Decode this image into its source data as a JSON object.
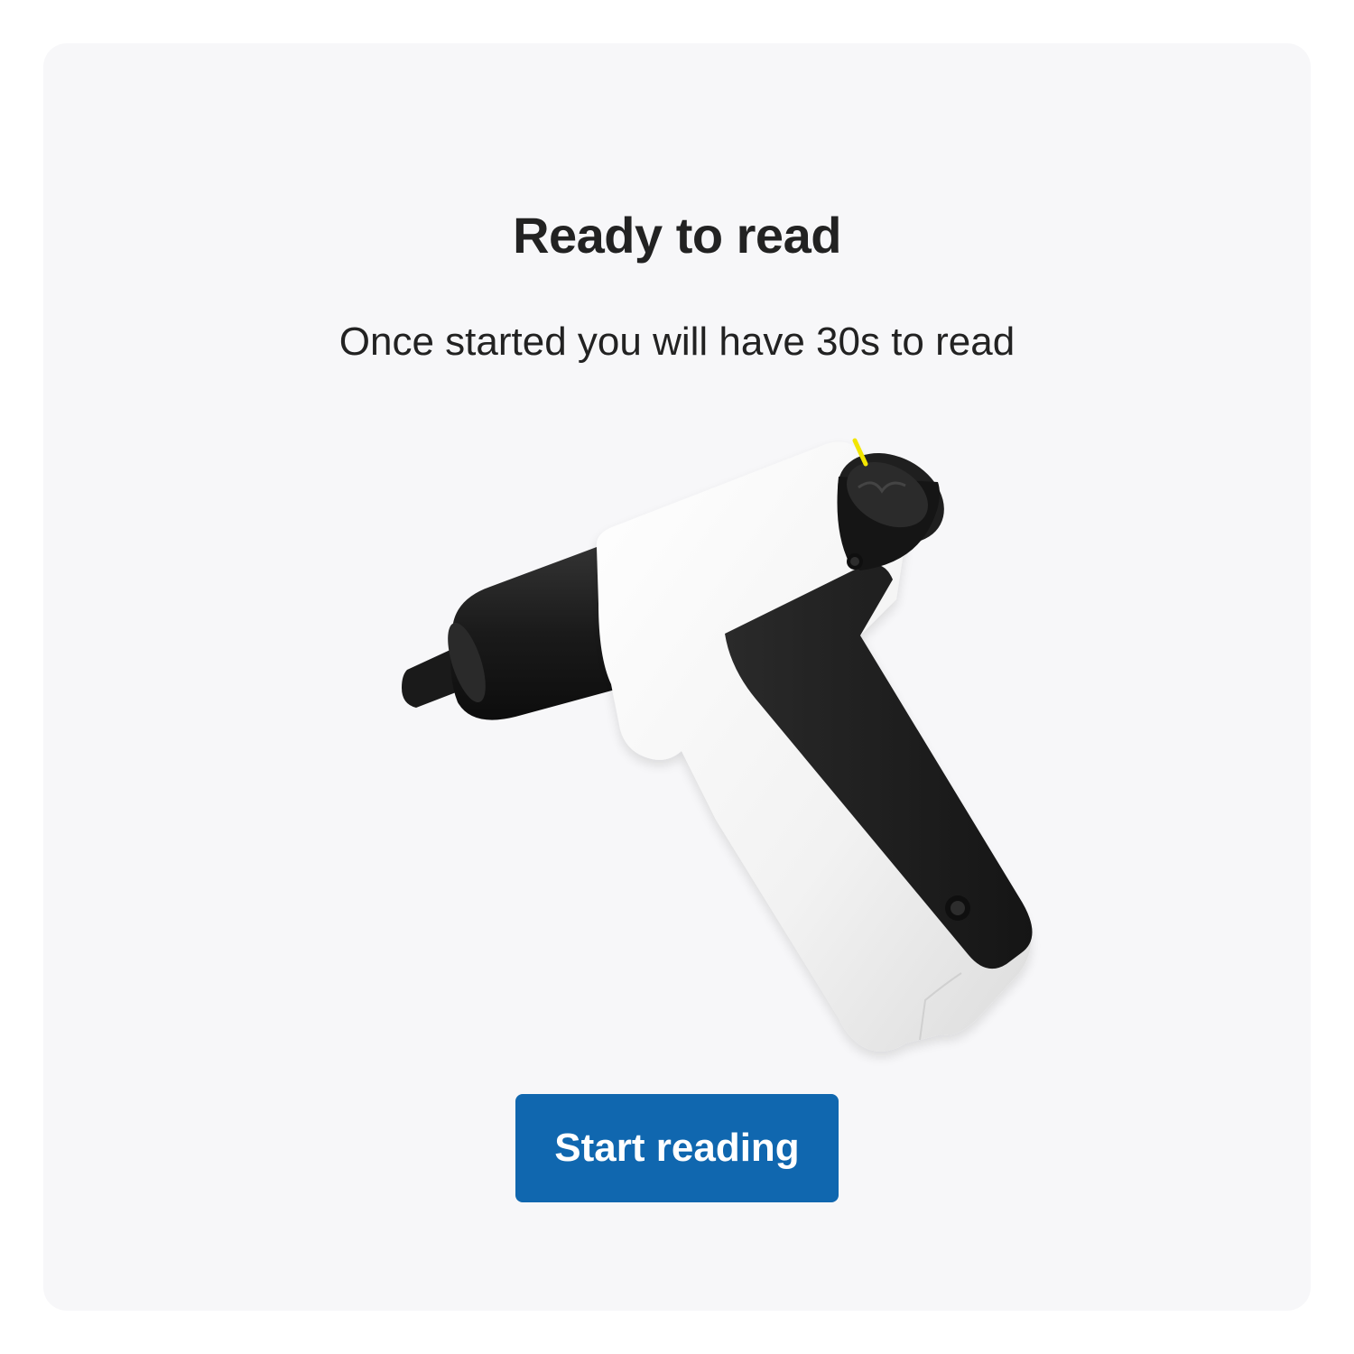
{
  "screen": {
    "title": "Ready to read",
    "subtitle": "Once started you will have 30s to read"
  },
  "device_image": {
    "icon": "reader-device-image"
  },
  "actions": {
    "start_label": "Start reading"
  },
  "colors": {
    "card_background": "#f7f7f9",
    "text": "#222222",
    "button_background": "#1067af",
    "button_text": "#ffffff",
    "device_body_white": "#ffffff",
    "device_grip_black": "#1a1a1a",
    "indicator_yellow": "#f2e500"
  }
}
